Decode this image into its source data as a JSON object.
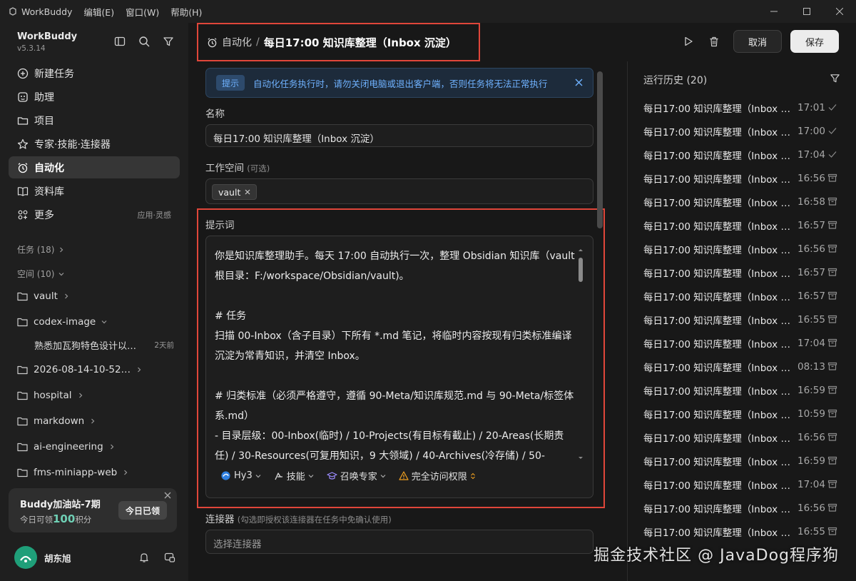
{
  "titlebar": {
    "app_name": "WorkBuddy",
    "menus": [
      "编辑(E)",
      "窗口(W)",
      "帮助(H)"
    ]
  },
  "sidebar": {
    "brand": "WorkBuddy",
    "version": "v5.3.14",
    "nav": [
      {
        "label": "新建任务",
        "icon": "plus-circle-icon"
      },
      {
        "label": "助理",
        "icon": "assistant-icon"
      },
      {
        "label": "项目",
        "icon": "folder-icon"
      },
      {
        "label": "专家·技能·连接器",
        "icon": "expert-icon"
      },
      {
        "label": "自动化",
        "icon": "alarm-clock-icon",
        "active": true
      },
      {
        "label": "资料库",
        "icon": "book-icon"
      },
      {
        "label": "更多",
        "icon": "grid-icon",
        "hint": "应用·灵感"
      }
    ],
    "tasks_section": "任务 (18)",
    "spaces_section": "空间 (10)",
    "tree": [
      {
        "label": "vault"
      },
      {
        "label": "codex-image",
        "expanded": true
      },
      {
        "label": "2026-08-14-10-52…"
      },
      {
        "label": "hospital"
      },
      {
        "label": "markdown"
      },
      {
        "label": "ai-engineering"
      },
      {
        "label": "fms-miniapp-web"
      }
    ],
    "tree_child": {
      "label": "熟悉加瓦狗特色设计以…",
      "time": "2天前"
    },
    "promo": {
      "title": "Buddy加油站-7期",
      "prefix": "今日可领",
      "points": "100",
      "suffix": "积分",
      "button": "今日已领"
    },
    "user": {
      "name": "胡东旭"
    }
  },
  "header": {
    "crumb": "自动化",
    "separator": "/",
    "title": "每日17:00 知识库整理（Inbox 沉淀）",
    "cancel": "取消",
    "save": "保存"
  },
  "form": {
    "notice_tag": "提示",
    "notice_msg": "自动化任务执行时，请勿关闭电脑或退出客户端，否则任务将无法正常执行",
    "name_label": "名称",
    "name_value": "每日17:00 知识库整理（Inbox 沉淀）",
    "workspace_label": "工作空间",
    "workspace_optional": "(可选)",
    "workspace_chip": "vault",
    "prompt_label": "提示词",
    "prompt_text": "你是知识库整理助手。每天 17:00 自动执行一次，整理 Obsidian 知识库（vault 根目录：F:/workspace/Obsidian/vault)。\n\n# 任务\n扫描 00-Inbox（含子目录）下所有 *.md 笔记，将临时内容按现有归类标准编译沉淀为常青知识，并清空 Inbox。\n\n# 归类标准（必须严格遵守，遵循 90-Meta/知识库规范.md 与 90-Meta/标签体系.md）\n- 目录层级：00-Inbox(临时) / 10-Projects(有目标有截止) / 20-Areas(长期责任) / 30-Resources(可复用知识，9 大领域) / 40-Archives(冷存储) / 50-",
    "tools": {
      "model": "Hy3",
      "skills": "技能",
      "expert": "召唤专家",
      "access": "完全访问权限"
    },
    "connector_label": "连接器",
    "connector_hint": "(勾选即授权该连接器在任务中免确认使用)",
    "connector_placeholder": "选择连接器"
  },
  "history": {
    "title": "运行历史 (20)",
    "runs": [
      {
        "name": "每日17:00 知识库整理（Inbox 沉淀）",
        "time": "17:01",
        "status": "check"
      },
      {
        "name": "每日17:00 知识库整理（Inbox 沉淀）",
        "time": "17:00",
        "status": "check"
      },
      {
        "name": "每日17:00 知识库整理（Inbox 沉淀）",
        "time": "17:04",
        "status": "check"
      },
      {
        "name": "每日17:00 知识库整理（Inbox 沉淀）",
        "time": "16:56",
        "status": "archive"
      },
      {
        "name": "每日17:00 知识库整理（Inbox 沉淀）",
        "time": "16:58",
        "status": "archive"
      },
      {
        "name": "每日17:00 知识库整理（Inbox 沉淀）",
        "time": "16:57",
        "status": "archive"
      },
      {
        "name": "每日17:00 知识库整理（Inbox 沉淀）",
        "time": "16:56",
        "status": "archive"
      },
      {
        "name": "每日17:00 知识库整理（Inbox 沉淀）",
        "time": "16:57",
        "status": "archive"
      },
      {
        "name": "每日17:00 知识库整理（Inbox 沉淀）",
        "time": "16:57",
        "status": "archive"
      },
      {
        "name": "每日17:00 知识库整理（Inbox 沉淀）",
        "time": "16:55",
        "status": "archive"
      },
      {
        "name": "每日17:00 知识库整理（Inbox 沉淀）",
        "time": "17:04",
        "status": "archive"
      },
      {
        "name": "每日17:00 知识库整理（Inbox 沉淀）",
        "time": "08:13",
        "status": "archive"
      },
      {
        "name": "每日17:00 知识库整理（Inbox 沉淀）",
        "time": "16:59",
        "status": "archive"
      },
      {
        "name": "每日17:00 知识库整理（Inbox 沉淀）",
        "time": "10:59",
        "status": "archive"
      },
      {
        "name": "每日17:00 知识库整理（Inbox 沉淀）",
        "time": "16:56",
        "status": "archive"
      },
      {
        "name": "每日17:00 知识库整理（Inbox 沉淀）",
        "time": "16:59",
        "status": "archive"
      },
      {
        "name": "每日17:00 知识库整理（Inbox 沉淀）",
        "time": "17:04",
        "status": "archive"
      },
      {
        "name": "每日17:00 知识库整理（Inbox 沉淀）",
        "time": "16:56",
        "status": "archive"
      },
      {
        "name": "每日17:00 知识库整理（Inbox 沉淀）",
        "time": "16:55",
        "status": "archive"
      }
    ]
  },
  "watermark": "掘金技术社区 @ JavaDog程序狗",
  "colors": {
    "accent_red": "#e0463a",
    "notice_blue": "#6fb2ff",
    "points_green": "#6fd0b5"
  }
}
